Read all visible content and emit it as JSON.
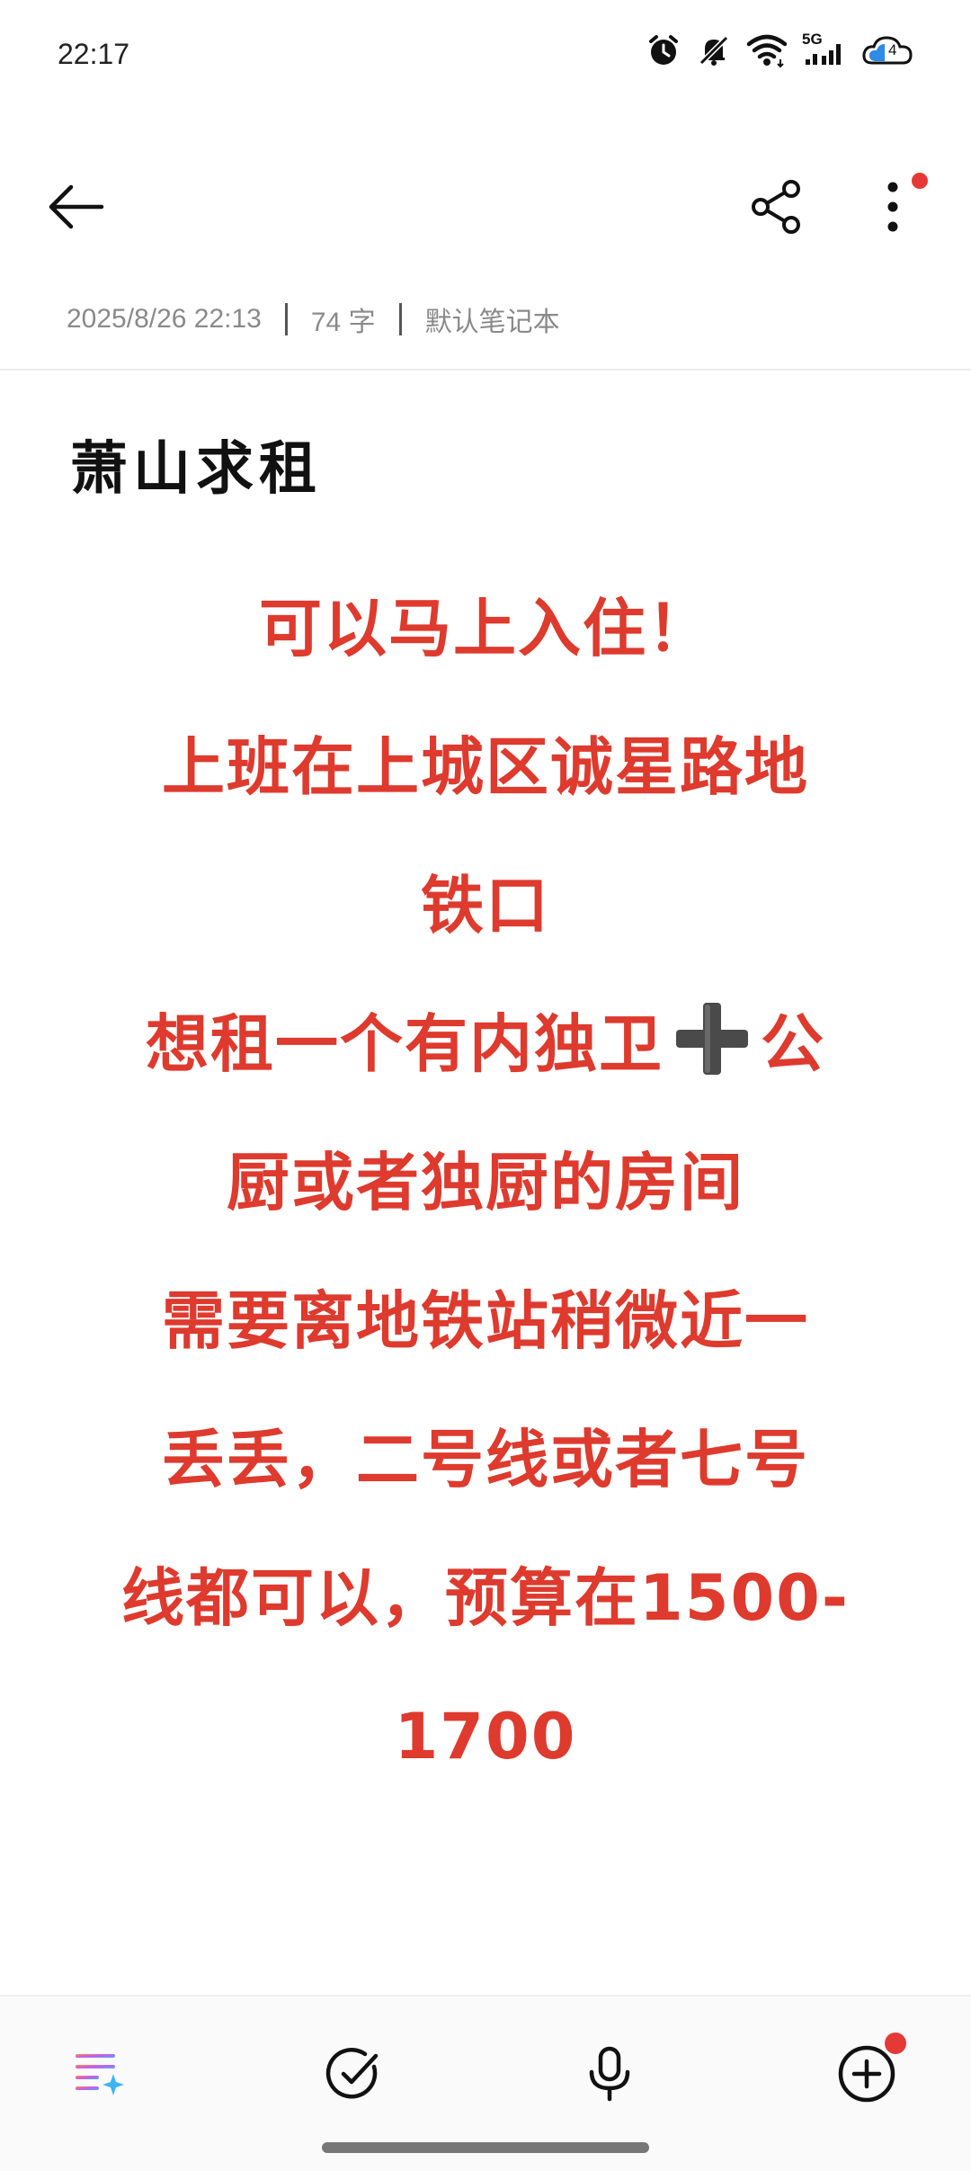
{
  "status_bar": {
    "time": "22:17",
    "icons": [
      "alarm-icon",
      "mute-icon",
      "wifi-icon",
      "5g-signal-icon",
      "cloud-battery-icon"
    ],
    "network_label": "5G",
    "badge_number": "4"
  },
  "top_bar": {
    "back_icon": "arrow-left-icon",
    "share_icon": "share-icon",
    "more_icon": "more-vertical-icon",
    "accent_dot_color": "#e53935"
  },
  "note": {
    "date": "2025/8/26 22:13",
    "word_count": "74 字",
    "notebook": "默认笔记本",
    "title": "萧山求租",
    "body_color": "#de3a2e",
    "lines": [
      "可以马上入住！",
      "上班在上城区诚星路地",
      "铁口",
      "想租一个有内独卫",
      "公",
      "厨或者独厨的房间",
      "需要离地铁站稍微近一",
      "丢丢，二号线或者七号",
      "线都可以，预算在1500-",
      "1700"
    ]
  },
  "bottom_bar": {
    "tools": [
      "ai-format-icon",
      "checklist-icon",
      "microphone-icon",
      "add-circle-icon"
    ]
  }
}
